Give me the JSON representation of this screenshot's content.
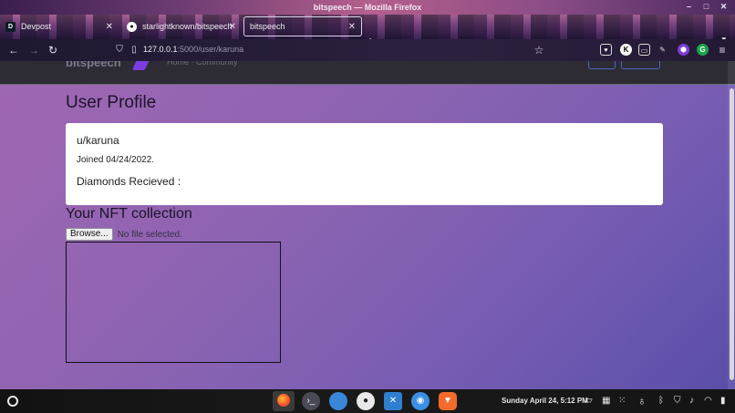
{
  "window": {
    "title": "bitspeech — Mozilla Firefox"
  },
  "tabs": [
    {
      "label": "Devpost",
      "favicon": "D"
    },
    {
      "label": "starlightknown/bitspeech",
      "favicon": "github-icon"
    },
    {
      "label": "bitspeech",
      "favicon": ""
    }
  ],
  "address_bar": {
    "host": "127.0.0.1",
    "path": ":5000/user/karuna"
  },
  "profile": {
    "heading": "User Profile",
    "username": "u/karuna",
    "joined": "Joined 04/24/2022.",
    "diamonds_label": "Diamonds Recieved :"
  },
  "nft": {
    "heading": "Your NFT collection",
    "browse_label": "Browse...",
    "file_status": "No file selected."
  },
  "taskbar": {
    "clock": "Sunday April 24,  5:12 PM"
  },
  "colors": {
    "accent": "#7a3ee0",
    "page_gradient_start": "#a067b2",
    "page_gradient_end": "#5a4ea8"
  }
}
